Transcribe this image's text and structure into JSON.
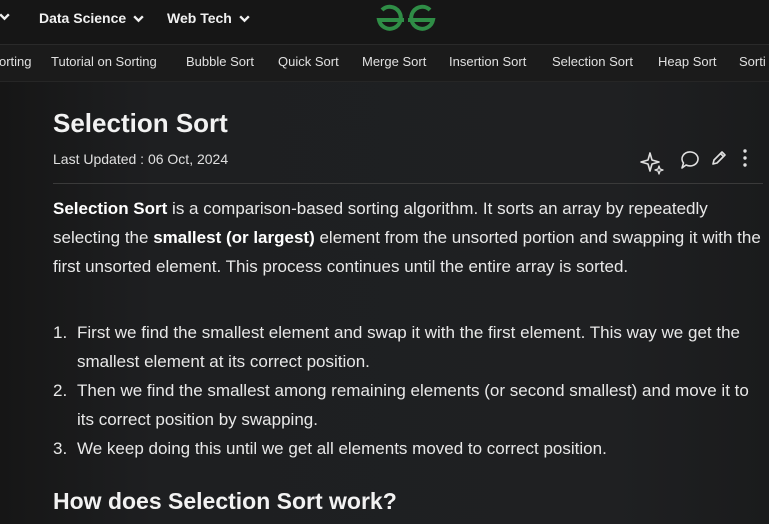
{
  "topnav": {
    "items": [
      {
        "label": "",
        "has_chevron": true
      },
      {
        "label": "Data Science",
        "has_chevron": true
      },
      {
        "label": "Web Tech",
        "has_chevron": true
      }
    ],
    "logo": "gfg-logo",
    "accent": "#2f8d46"
  },
  "subnav": {
    "items": [
      "orting",
      "Tutorial on Sorting",
      "Bubble Sort",
      "Quick Sort",
      "Merge Sort",
      "Insertion Sort",
      "Selection Sort",
      "Heap Sort",
      "Sorti"
    ]
  },
  "article": {
    "title": "Selection Sort",
    "last_updated": "Last Updated : 06 Oct, 2024",
    "actions": [
      "sparkle-ai-icon",
      "comment-icon",
      "edit-pencil-icon",
      "more-vertical-icon"
    ],
    "intro": {
      "bold1": "Selection Sort",
      "text1": " is a comparison-based sorting algorithm. It sorts an array by repeatedly selecting the ",
      "bold2": "smallest (or largest)",
      "text2": " element from the unsorted portion and swapping it with the first unsorted element. This process continues until the entire array is sorted."
    },
    "steps": [
      {
        "num": "1.",
        "text": "First we find the smallest element and swap it with the first element. This way we get the smallest element at its correct position."
      },
      {
        "num": "2.",
        "text": "Then we find the smallest among remaining elements (or second smallest) and move it to its correct position by swapping."
      },
      {
        "num": "3.",
        "text": "We keep doing this until we get all elements moved to correct position."
      }
    ],
    "section_heading": "How does Selection Sort work?"
  }
}
